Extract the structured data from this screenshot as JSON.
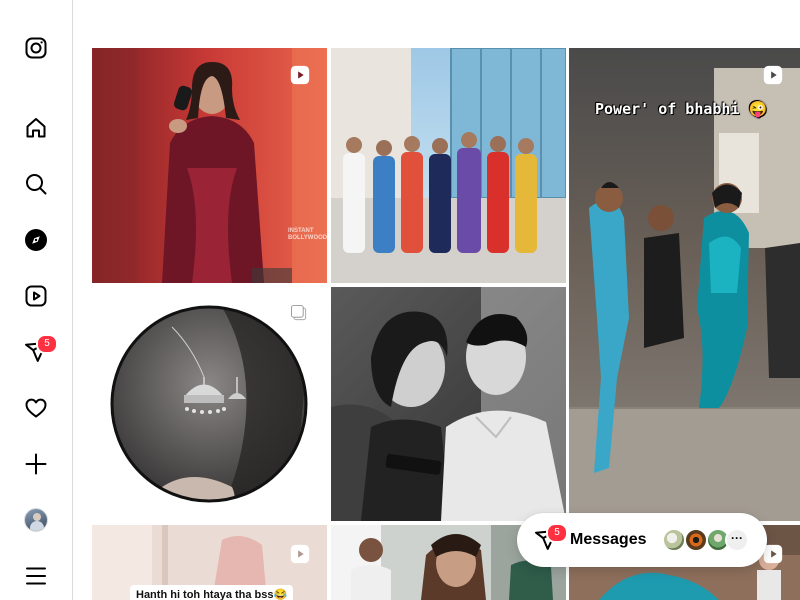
{
  "sidebar": {
    "items": [
      {
        "name": "instagram-logo-icon",
        "label": "Instagram"
      },
      {
        "name": "home-icon",
        "label": "Home"
      },
      {
        "name": "search-icon",
        "label": "Search"
      },
      {
        "name": "explore-icon",
        "label": "Explore"
      },
      {
        "name": "reels-icon",
        "label": "Reels"
      },
      {
        "name": "messages-icon",
        "label": "Messages"
      },
      {
        "name": "heart-icon",
        "label": "Notifications"
      },
      {
        "name": "create-icon",
        "label": "Create"
      },
      {
        "name": "profile-avatar",
        "label": "Profile"
      },
      {
        "name": "menu-icon",
        "label": "More"
      }
    ],
    "messages_badge": "5"
  },
  "posts": [
    {
      "type": "reel",
      "subject": "woman speaking into microphone on stage",
      "watermark": "INSTANT\nBOLLYWOOD"
    },
    {
      "type": "photo",
      "subject": "group of seven women in colorful suits"
    },
    {
      "type": "reel",
      "subject": "people dancing in street",
      "overlay_text": "Power' of bhabhi 😜"
    },
    {
      "type": "carousel",
      "subject": "circular photo of silver jhumka earrings"
    },
    {
      "type": "photo",
      "subject": "black and white couple portrait"
    },
    {
      "type": "reel",
      "subject": "girl in room",
      "overlay_text": "Hanth hi toh htaya tha bss😂"
    },
    {
      "type": "photo",
      "subject": "crowd outdoors"
    },
    {
      "type": "reel",
      "subject": "street scene"
    }
  ],
  "messages_widget": {
    "label": "Messages",
    "badge": "5",
    "more": "···"
  },
  "colors": {
    "badge": "#ff3040",
    "border": "#dbdbdb",
    "text": "#000000"
  }
}
